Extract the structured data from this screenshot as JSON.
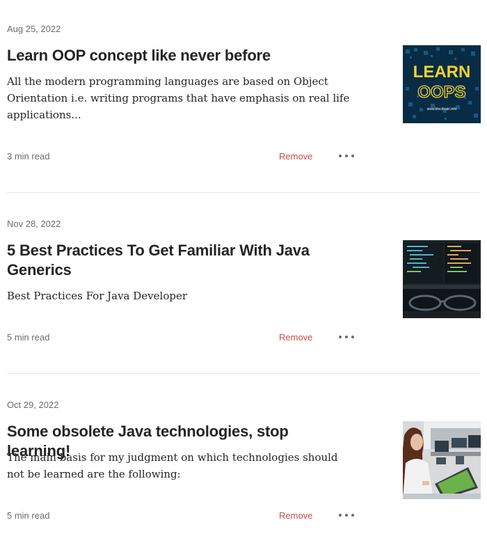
{
  "articles": [
    {
      "date": "Aug 25, 2022",
      "title": "Learn OOP concept like never before",
      "subtitle": "All the modern programming languages are based on Object Orientation i.e. writing programs that have emphasis on real life applications...",
      "read_time": "3 min read",
      "remove_label": "Remove",
      "thumb": {
        "line1": "LEARN",
        "line2": "OOPS",
        "caption": "www.blocktrain.info"
      }
    },
    {
      "date": "Nov 28, 2022",
      "title": "5 Best Practices To Get Familiar With Java Generics",
      "subtitle": "Best Practices For Java Developer",
      "read_time": "5 min read",
      "remove_label": "Remove"
    },
    {
      "date": "Oct 29, 2022",
      "title": "Some obsolete Java technologies, stop learning!",
      "subtitle": "The main basis for my judgment on which technologies should not be learned are the following:",
      "read_time": "5 min read",
      "remove_label": "Remove"
    }
  ],
  "colors": {
    "remove": "#c94a4a",
    "meta": "#6b6b6b",
    "divider": "#e6e6e6",
    "oops_yellow": "#f5d230"
  }
}
